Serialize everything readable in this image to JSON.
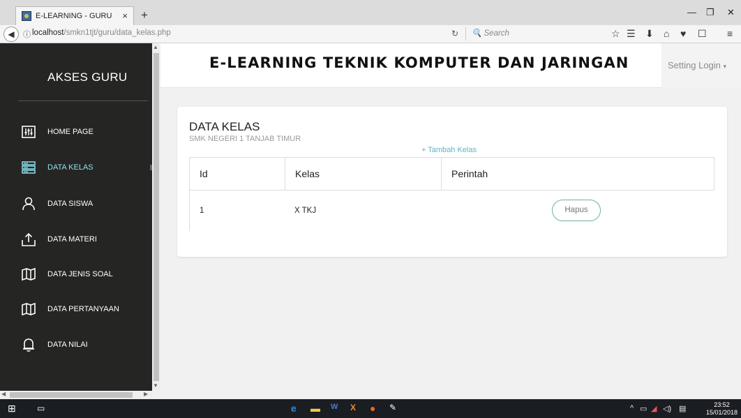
{
  "browser": {
    "tab_title": "E-LEARNING - GURU",
    "url_host": "localhost",
    "url_path": "/smkn1tjt/guru/data_kelas.php",
    "search_placeholder": "Search"
  },
  "sidebar": {
    "brand": "AKSES GURU",
    "items": [
      {
        "label": "HOME PAGE",
        "icon": "sliders-icon"
      },
      {
        "label": "DATA KELAS",
        "icon": "server-icon"
      },
      {
        "label": "DATA SISWA",
        "icon": "user-icon"
      },
      {
        "label": "DATA MATERI",
        "icon": "upload-icon"
      },
      {
        "label": "DATA JENIS SOAL",
        "icon": "map-icon"
      },
      {
        "label": "DATA PERTANYAAN",
        "icon": "map-icon"
      },
      {
        "label": "DATA NILAI",
        "icon": "bell-icon"
      }
    ],
    "active_item": "DATA KELAS"
  },
  "header": {
    "title": "E-LEARNING TEKNIK KOMPUTER DAN JARINGAN",
    "setting_login": "Setting Login"
  },
  "main": {
    "title": "DATA KELAS",
    "subtitle": "SMK NEGERI 1 TANJAB TIMUR",
    "add_link": "+ Tambah Kelas",
    "table": {
      "columns": [
        "Id",
        "Kelas",
        "Perintah"
      ],
      "rows": [
        {
          "id": "1",
          "kelas": "X TKJ",
          "action": "Hapus"
        }
      ]
    }
  },
  "taskbar": {
    "time": "23:52",
    "date": "15/01/2018"
  },
  "colors": {
    "sidebar_bg": "#252523",
    "active_item": "#8fe1f0",
    "link": "#5ab5c7",
    "button_border": "#6db1a6"
  }
}
